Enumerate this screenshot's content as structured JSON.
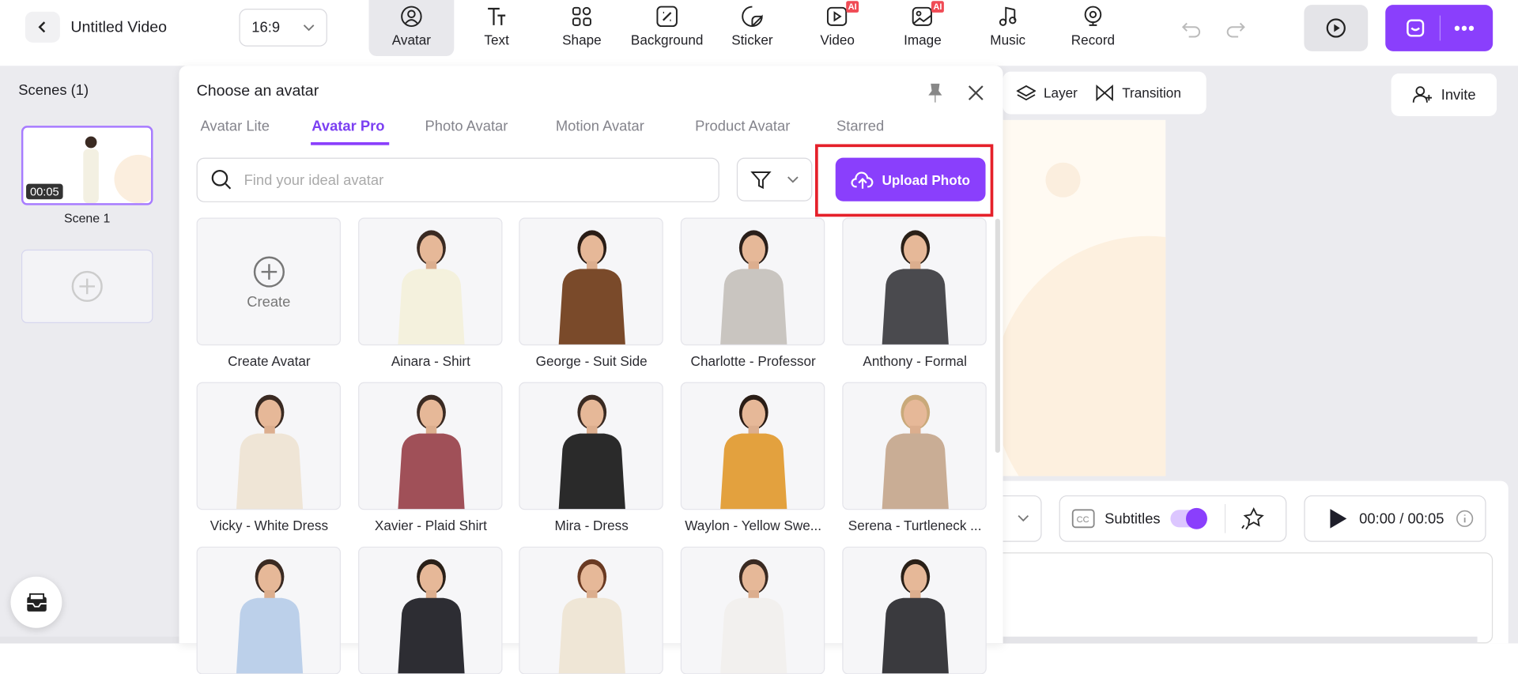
{
  "header": {
    "title": "Untitled Video",
    "aspect": "16:9",
    "tools": [
      {
        "label": "Avatar",
        "icon": "avatar-icon",
        "active": true
      },
      {
        "label": "Text",
        "icon": "text-icon"
      },
      {
        "label": "Shape",
        "icon": "shape-icon"
      },
      {
        "label": "Background",
        "icon": "background-icon"
      },
      {
        "label": "Sticker",
        "icon": "sticker-icon"
      },
      {
        "label": "Video",
        "icon": "video-icon",
        "badge": "AI"
      },
      {
        "label": "Image",
        "icon": "image-icon",
        "badge": "AI"
      },
      {
        "label": "Music",
        "icon": "music-icon"
      },
      {
        "label": "Record",
        "icon": "record-icon"
      }
    ]
  },
  "scenes": {
    "title": "Scenes (1)",
    "items": [
      {
        "label": "Scene 1",
        "duration": "00:05"
      }
    ]
  },
  "panel": {
    "title": "Choose an avatar",
    "tabs": [
      "Avatar Lite",
      "Avatar Pro",
      "Photo Avatar",
      "Motion Avatar",
      "Product Avatar",
      "Starred"
    ],
    "active_tab": "Avatar Pro",
    "search_placeholder": "Find your ideal avatar",
    "upload_label": "Upload Photo",
    "create_label": "Create",
    "avatars": [
      "Create Avatar",
      "Ainara - Shirt",
      "George - Suit Side",
      "Charlotte - Professor",
      "Anthony - Formal",
      "Vicky - White Dress",
      "Xavier - Plaid Shirt",
      "Mira - Dress",
      "Waylon - Yellow Swe...",
      "Serena - Turtleneck ..."
    ]
  },
  "canvas": {
    "layer_label": "Layer",
    "transition_label": "Transition",
    "invite_label": "Invite"
  },
  "playback": {
    "subtitles_label": "Subtitles",
    "subtitles_on": true,
    "time": "00:00 / 00:05"
  },
  "colors": {
    "accent": "#8a3ffc",
    "highlight": "#e5202a"
  }
}
